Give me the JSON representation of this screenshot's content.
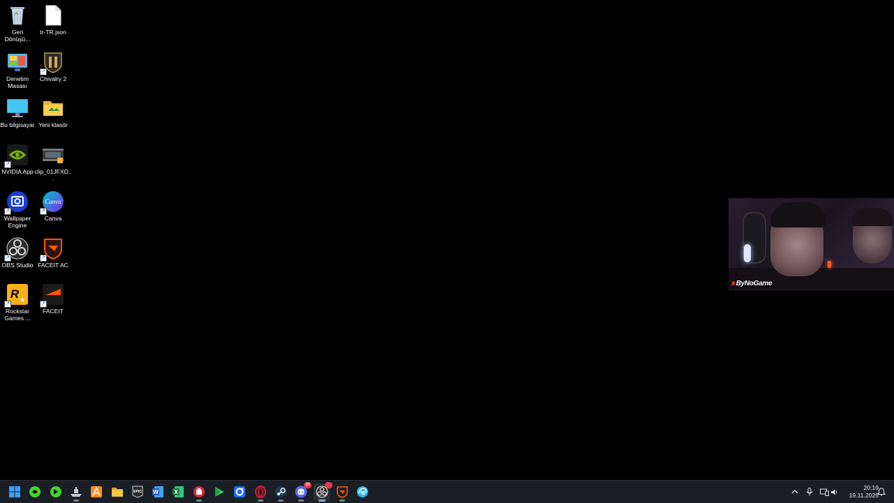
{
  "desktop": {
    "icons": [
      {
        "label": "Geri Dönüşü...",
        "icon": "recycle-bin-icon"
      },
      {
        "label": "tr-TR.json",
        "icon": "file-icon"
      },
      {
        "label": "Denetim Masası",
        "icon": "control-panel-icon"
      },
      {
        "label": "Chivalry 2",
        "icon": "chivalry-icon"
      },
      {
        "label": "Bu bilgisayar",
        "icon": "computer-icon"
      },
      {
        "label": "Yeni klasör",
        "icon": "folder-icon"
      },
      {
        "label": "NVIDIA App",
        "icon": "nvidia-icon"
      },
      {
        "label": "clip_01JFXD...",
        "icon": "video-file-icon"
      },
      {
        "label": "Wallpaper Engine",
        "icon": "wallpaper-engine-icon"
      },
      {
        "label": "Canva",
        "icon": "canva-icon"
      },
      {
        "label": "OBS Studio",
        "icon": "obs-icon"
      },
      {
        "label": "FACEIT AC",
        "icon": "faceit-ac-icon"
      },
      {
        "label": "Rockstar Games ...",
        "icon": "rockstar-icon"
      },
      {
        "label": "FACEIT",
        "icon": "faceit-icon"
      }
    ]
  },
  "webcam": {
    "tag": "ByNoGame",
    "tag_icon": "fire-icon"
  },
  "taskbar": {
    "apps": [
      {
        "icon": "windows-start-icon",
        "label": "",
        "color": "#3aa0ff"
      },
      {
        "icon": "razer-icon",
        "label": "",
        "color": "#44d62c"
      },
      {
        "icon": "razer-cortex-icon",
        "label": "",
        "color": "#44d62c"
      },
      {
        "icon": "ship-game-icon",
        "label": "",
        "color": "#c9ccd1"
      },
      {
        "icon": "aimp-icon",
        "label": "",
        "color": "#ff8a1f"
      },
      {
        "icon": "file-explorer-icon",
        "label": "",
        "color": "#f2c744"
      },
      {
        "icon": "epic-games-icon",
        "label": "EPIC",
        "color": "#2a2a2a"
      },
      {
        "icon": "word-icon",
        "label": "W",
        "color": "#2b5fb8"
      },
      {
        "icon": "excel-icon",
        "label": "X",
        "color": "#1e7b45"
      },
      {
        "icon": "red-app-icon",
        "label": "",
        "color": "#e0283b"
      },
      {
        "icon": "google-play-games-icon",
        "label": "",
        "color": "#34c759"
      },
      {
        "icon": "blue-app-icon",
        "label": "",
        "color": "#1c6ef2"
      },
      {
        "icon": "opera-gx-icon",
        "label": "",
        "color": "#e3143c"
      },
      {
        "icon": "steam-icon",
        "label": "",
        "color": "#1b3a5e"
      },
      {
        "icon": "discord-icon",
        "label": "",
        "color": "#5865f2",
        "badge": "99"
      },
      {
        "icon": "obs-taskbar-icon",
        "label": "",
        "color": "#e7e7e7",
        "badge": " "
      },
      {
        "icon": "faceit-ac-taskbar-icon",
        "label": "",
        "color": "#ff5500"
      },
      {
        "icon": "edge-icon",
        "label": "",
        "color": "#2bb4e8"
      }
    ],
    "tray": {
      "icons": [
        "chevron-up-icon",
        "microphone-icon",
        "network-icon",
        "volume-icon"
      ],
      "time": "20:19",
      "date": "19.11.2025",
      "notification_icon": "notification-icon"
    }
  }
}
